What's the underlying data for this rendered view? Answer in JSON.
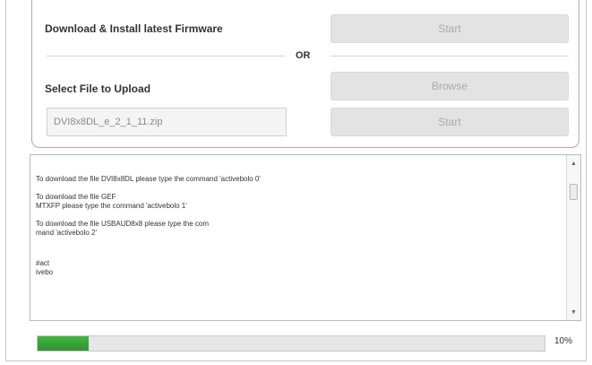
{
  "firmware": {
    "download_label": "Download & Install latest Firmware",
    "download_start_label": "Start",
    "or_label": "OR",
    "upload_label": "Select File to Upload",
    "browse_label": "Browse",
    "file_name": "DVI8x8DL_e_2_1_11.zip",
    "upload_start_label": "Start"
  },
  "log": {
    "lines": [
      "To download the file DVI8x8DL please type the command 'activebolo 0'",
      "",
      "To download the file GEF",
      "MTXFP please type the command 'activebolo 1'",
      "",
      "To download the file USBAUD8x8 please type the com",
      "mand 'activebolo 2'",
      "",
      "",
      "#act",
      "ivebo"
    ]
  },
  "progress": {
    "value": 0.1,
    "label": "10%",
    "fill_color": "#3aa63a"
  }
}
